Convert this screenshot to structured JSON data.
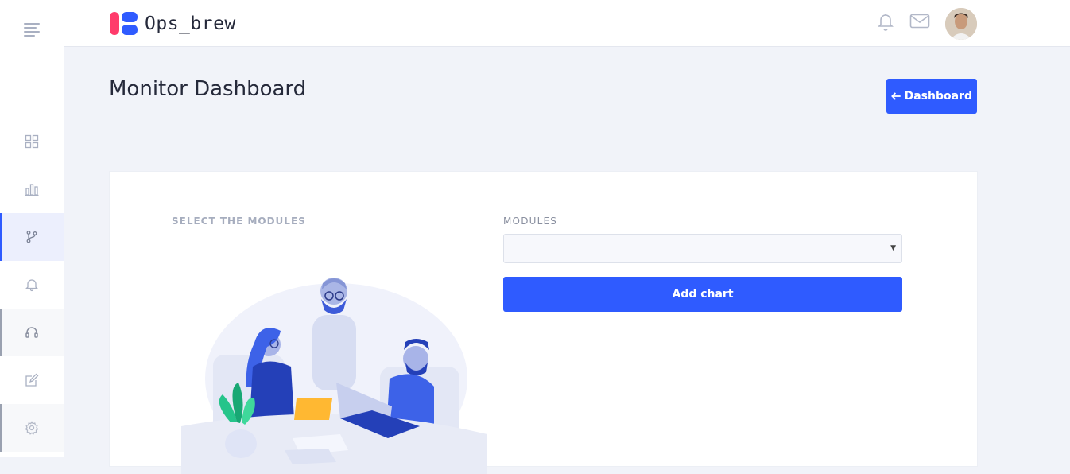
{
  "brand": {
    "name": "Ops_brew"
  },
  "header": {
    "icons": [
      "bell-icon",
      "mail-icon",
      "user-avatar"
    ]
  },
  "sidebar": {
    "items": [
      {
        "icon": "grid-icon",
        "state": "default"
      },
      {
        "icon": "bar-chart-icon",
        "state": "default"
      },
      {
        "icon": "git-branch-icon",
        "state": "active"
      },
      {
        "icon": "bell-icon",
        "state": "default"
      },
      {
        "icon": "headset-icon",
        "state": "highlighted"
      },
      {
        "icon": "edit-icon",
        "state": "default"
      },
      {
        "icon": "settings-icon",
        "state": "highlighted"
      }
    ]
  },
  "page": {
    "title": "Monitor Dashboard",
    "back_button_label": "Dashboard"
  },
  "card": {
    "section_label": "SELECT THE MODULES",
    "modules_label": "MODULES",
    "modules_selected": "",
    "add_button_label": "Add chart"
  },
  "colors": {
    "accent": "#2f5bff",
    "brand_pink": "#ff3b6b",
    "background": "#f1f3f9"
  }
}
